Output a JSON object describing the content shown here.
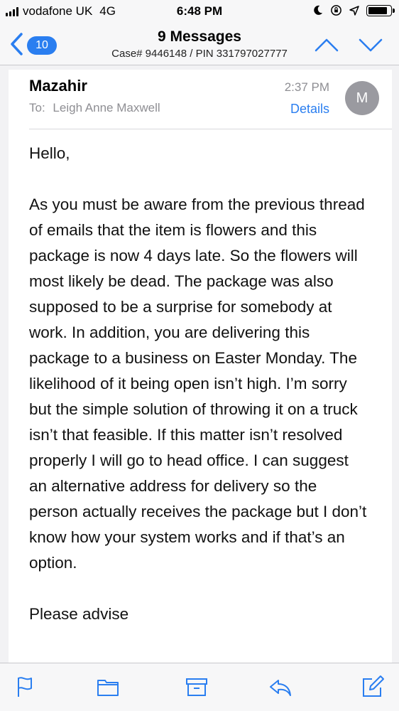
{
  "status_bar": {
    "carrier": "vodafone UK",
    "network": "4G",
    "time": "6:48 PM",
    "battery_level": 0.85
  },
  "nav": {
    "back_count": "10",
    "title": "9 Messages",
    "subtitle": "Case# 9446148 / PIN 331797027777"
  },
  "message": {
    "sender": "Mazahir",
    "time": "2:37 PM",
    "to_label": "To:",
    "to": "Leigh Anne Maxwell",
    "details_label": "Details",
    "avatar_initial": "M",
    "body": [
      "Hello,",
      "As you must be aware from the previous thread of emails that the item is flowers and this package is now 4 days late. So the flowers will most likely be dead. The package was also supposed to be a surprise for somebody at work.  In addition, you are delivering this package to a business on Easter Monday. The likelihood of it being open isn’t high. I’m sorry but the simple solution of throwing it on a truck isn’t that feasible. If this matter isn’t resolved properly I will go to head office.  I can suggest an alternative address for delivery so the person actually receives the package but I don’t know how your system works and if that’s an option.",
      "Please advise"
    ]
  },
  "toolbar": {
    "icons": [
      "flag-icon",
      "folder-icon",
      "archive-icon",
      "reply-icon",
      "compose-icon"
    ]
  },
  "colors": {
    "accent": "#2a7ef0",
    "secondary_text": "#8e8e93"
  }
}
